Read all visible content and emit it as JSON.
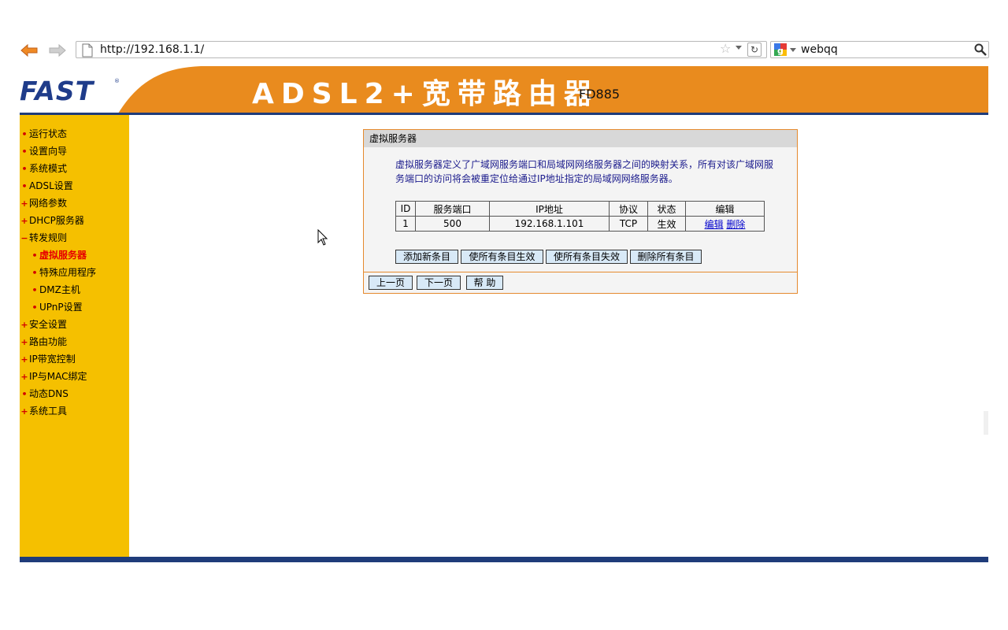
{
  "browser": {
    "url": "http://192.168.1.1/",
    "search_engine_icon": "google-icon",
    "search_text": "webqq"
  },
  "header": {
    "logo": "FAST",
    "logo_mark": "®",
    "title": "ADSL2+宽带路由器",
    "model": "FD885",
    "colors": {
      "orange": "#e98b1e",
      "blue": "#1f3c8a"
    }
  },
  "sidebar": {
    "items": [
      {
        "label": "运行状态",
        "marker": "•"
      },
      {
        "label": "设置向导",
        "marker": "•"
      },
      {
        "label": "系统模式",
        "marker": "•"
      },
      {
        "label": "ADSL设置",
        "marker": "•"
      },
      {
        "label": "网络参数",
        "marker": "+"
      },
      {
        "label": "DHCP服务器",
        "marker": "+"
      },
      {
        "label": "转发规则",
        "marker": "−"
      },
      {
        "label": "虚拟服务器",
        "marker": "•",
        "sub": true,
        "active": true
      },
      {
        "label": "特殊应用程序",
        "marker": "•",
        "sub": true
      },
      {
        "label": "DMZ主机",
        "marker": "•",
        "sub": true
      },
      {
        "label": "UPnP设置",
        "marker": "•",
        "sub": true
      },
      {
        "label": "安全设置",
        "marker": "+"
      },
      {
        "label": "路由功能",
        "marker": "+"
      },
      {
        "label": "IP带宽控制",
        "marker": "+"
      },
      {
        "label": "IP与MAC绑定",
        "marker": "+"
      },
      {
        "label": "动态DNS",
        "marker": "•"
      },
      {
        "label": "系统工具",
        "marker": "+"
      }
    ]
  },
  "panel": {
    "title": "虚拟服务器",
    "description": "虚拟服务器定义了广域网服务端口和局域网网络服务器之间的映射关系，所有对该广域网服务端口的访问将会被重定位给通过IP地址指定的局域网网络服务器。",
    "table": {
      "headers": [
        "ID",
        "服务端口",
        "IP地址",
        "协议",
        "状态",
        "编辑"
      ],
      "rows": [
        {
          "id": "1",
          "port": "500",
          "ip": "192.168.1.101",
          "protocol": "TCP",
          "status": "生效",
          "edit": "编辑",
          "delete": "删除"
        }
      ]
    },
    "buttons": {
      "add": "添加新条目",
      "enable_all": "使所有条目生效",
      "disable_all": "使所有条目失效",
      "delete_all": "删除所有条目"
    },
    "nav": {
      "prev": "上一页",
      "next": "下一页",
      "help": "帮 助"
    }
  }
}
